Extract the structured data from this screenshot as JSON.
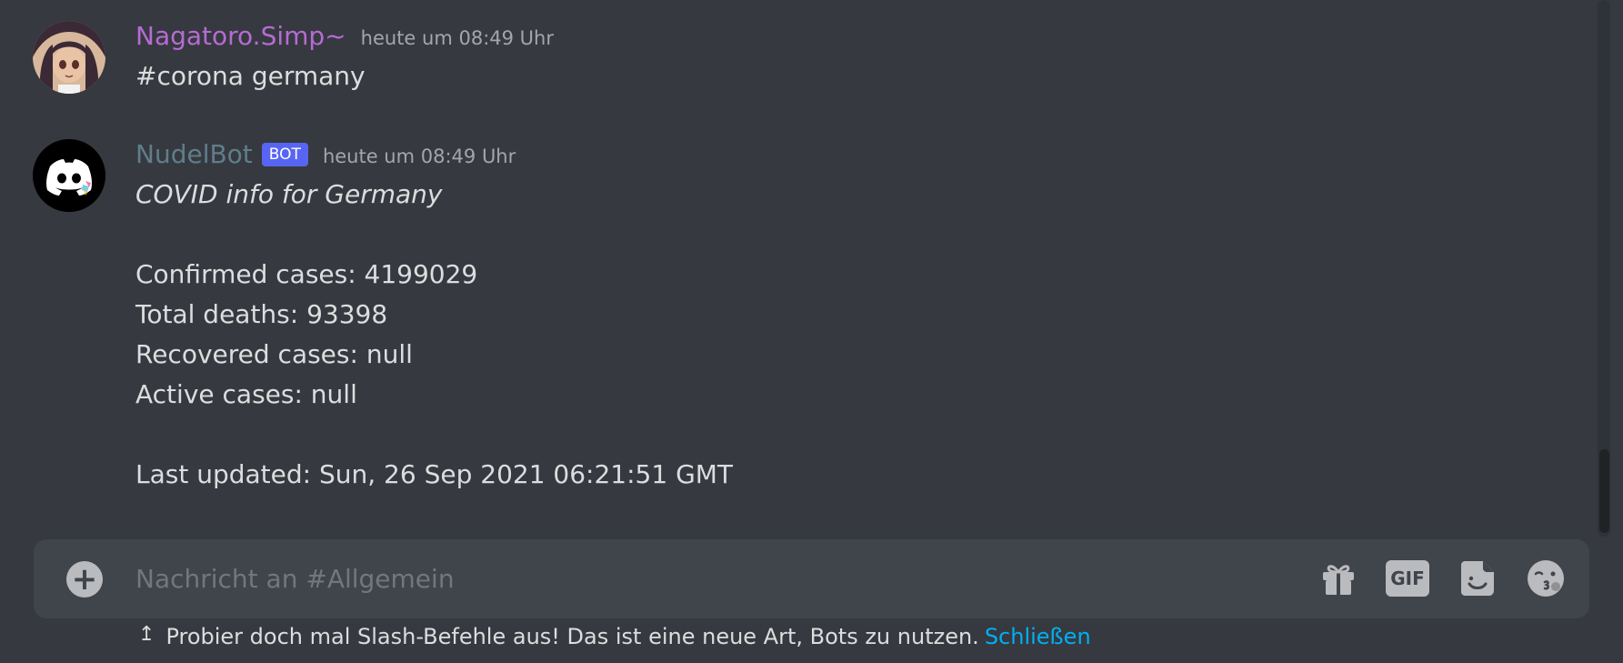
{
  "messages": [
    {
      "username": "Nagatoro.Simp~",
      "username_color": "#b66bd3",
      "timestamp": "heute um 08:49 Uhr",
      "content": "#corona germany"
    },
    {
      "username": "NudelBot",
      "username_color": "#607d8b",
      "bot_tag": "BOT",
      "timestamp": "heute um 08:49 Uhr",
      "lines": [
        "COVID info for Germany",
        "Confirmed cases: 4199029",
        "Total deaths: 93398",
        "Recovered cases: null",
        "Active cases: null",
        "Last updated: Sun, 26 Sep 2021 06:21:51 GMT"
      ]
    }
  ],
  "composer": {
    "placeholder": "Nachricht an #Allgemein",
    "add_icon": "plus-circle-icon",
    "tools": [
      "gift-icon",
      "gif-icon",
      "sticker-icon",
      "emoji-icon"
    ],
    "gif_label": "GIF"
  },
  "hint": {
    "icon": "arrow-up-icon",
    "text": "Probier doch mal Slash-Befehle aus! Das ist eine neue Art, Bots zu nutzen.",
    "link": "Schließen"
  }
}
